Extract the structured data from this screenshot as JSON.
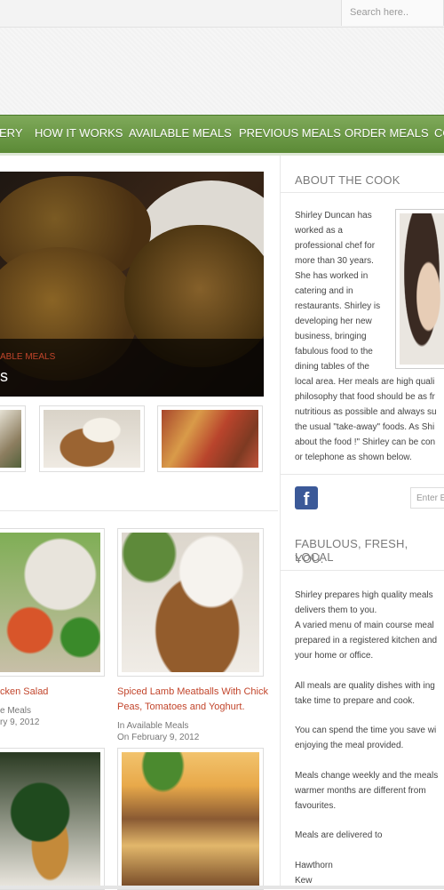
{
  "search": {
    "placeholder": "Search here.."
  },
  "nav": {
    "items": [
      "ERY",
      "HOW IT WORKS",
      "AVAILABLE MEALS",
      "PREVIOUS MEALS",
      "ORDER MEALS",
      "CO"
    ]
  },
  "hero": {
    "category": "ABLE MEALS",
    "title": "s"
  },
  "cards": [
    {
      "title": "cken Salad",
      "meta": [
        "e Meals",
        "ry 9, 2012"
      ]
    },
    {
      "title": "Spiced Lamb Meatballs With Chick Peas, Tomatoes and Yoghurt.",
      "meta": [
        "In Available Meals",
        "On February 9, 2012"
      ]
    }
  ],
  "sidebar": {
    "about_heading": "ABOUT THE COOK",
    "about_lines": [
      "Shirley Duncan has",
      "worked as a",
      "professional chef for",
      "more than 30 years.",
      "She has worked in",
      "catering and in",
      "restaurants. Shirley is",
      "developing her new",
      "business, bringing",
      "fabulous food to the",
      "dining tables of the",
      "local area. Her meals are high quali",
      "philosophy that food should be as fr",
      "nutritious as possible and always su",
      "the usual \"take-away\" foods. As Shi",
      "about the food !\" Shirley can be con",
      "or telephone as shown below."
    ],
    "email_placeholder": "Enter E",
    "fresh_heading_1": "FABULOUS, FRESH, LOCAL",
    "fresh_heading_2": "YOU.",
    "paragraphs": [
      [
        "Shirley prepares high quality meals",
        "delivers them to you.",
        "A varied menu of main course meal",
        "prepared in a registered kitchen and",
        "your home or office."
      ],
      [
        "All meals are quality dishes with ing",
        "take time to prepare and cook."
      ],
      [
        "You can spend the time you save wi",
        "enjoying the meal provided."
      ],
      [
        "Meals change weekly and the meals",
        "warmer months are different from",
        "favourites."
      ],
      [
        "Meals are delivered to"
      ],
      [
        "Hawthorn",
        "Kew"
      ]
    ]
  }
}
